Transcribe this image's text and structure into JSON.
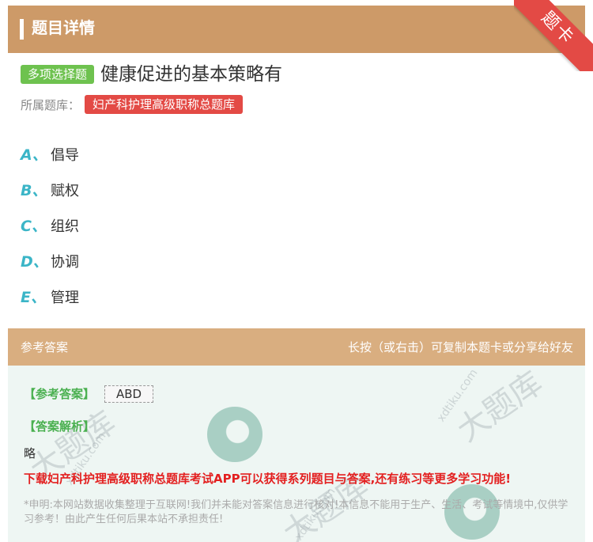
{
  "header": {
    "title": "题目详情",
    "ribbon": "题卡"
  },
  "question": {
    "type": "多项选择题",
    "text": "健康促进的基本策略有",
    "bank_label": "所属题库：",
    "bank_name": "妇产科护理高级职称总题库"
  },
  "options": [
    {
      "letter": "A、",
      "text": "倡导"
    },
    {
      "letter": "B、",
      "text": "赋权"
    },
    {
      "letter": "C、",
      "text": "组织"
    },
    {
      "letter": "D、",
      "text": "协调"
    },
    {
      "letter": "E、",
      "text": "管理"
    }
  ],
  "answer_section": {
    "title": "参考答案",
    "hint": "长按（或右击）可复制本题卡或分享给好友",
    "answer_label": "【参考答案】",
    "answer_value": "ABD",
    "analysis_label": "【答案解析】",
    "analysis_text": "略",
    "promo": "下载妇产科护理高级职称总题库考试APP可以获得系列题目与答案,还有练习等更多学习功能!",
    "disclaimer": "*申明:本网站数据收集整理于互联网!我们并未能对答案信息进行核对!本信息不能用于生产、生活、考试等情境中,仅供学习参考！由此产生任何后果本站不承担责任!"
  },
  "watermark": {
    "text": "大题库",
    "url": "xdtiku.com"
  },
  "colors": {
    "header": "#cd9a68",
    "answer_header": "#d9ae80",
    "accent_red": "#e34a45",
    "accent_green": "#6ec24f",
    "option_letter": "#3bb5c7"
  }
}
